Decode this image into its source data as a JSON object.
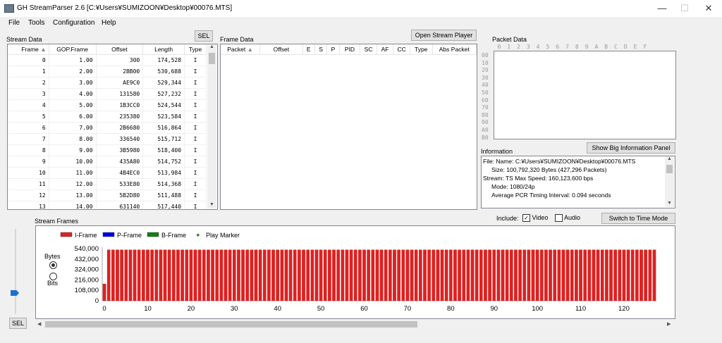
{
  "window": {
    "title": "GH StreamParser 2.6 [C:¥Users¥SUMIZOON¥Desktop¥00076.MTS]",
    "minimize": "—",
    "maximize": "☐",
    "close": "✕"
  },
  "menu": [
    "File",
    "Tools",
    "Configuration",
    "Help"
  ],
  "stream_data": {
    "label": "Stream Data",
    "sel_label": "SEL",
    "columns": [
      "Frame",
      "GOP.Frame",
      "Offset",
      "Length",
      "Type"
    ],
    "rows": [
      [
        "0",
        "1.00",
        "300",
        "174,528",
        "I"
      ],
      [
        "1",
        "2.00",
        "2BB00",
        "530,688",
        "I"
      ],
      [
        "2",
        "3.00",
        "AE9C0",
        "529,344",
        "I"
      ],
      [
        "3",
        "4.00",
        "131580",
        "527,232",
        "I"
      ],
      [
        "4",
        "5.00",
        "1B3CC0",
        "524,544",
        "I"
      ],
      [
        "5",
        "6.00",
        "235380",
        "523,584",
        "I"
      ],
      [
        "6",
        "7.00",
        "2B6680",
        "516,864",
        "I"
      ],
      [
        "7",
        "8.00",
        "336540",
        "515,712",
        "I"
      ],
      [
        "8",
        "9.00",
        "3B5980",
        "518,400",
        "I"
      ],
      [
        "9",
        "10.00",
        "435A80",
        "514,752",
        "I"
      ],
      [
        "10",
        "11.00",
        "4B4EC0",
        "513,984",
        "I"
      ],
      [
        "11",
        "12.00",
        "533E80",
        "514,368",
        "I"
      ],
      [
        "12",
        "13.00",
        "5B2D80",
        "511,488",
        "I"
      ],
      [
        "13",
        "14.00",
        "631140",
        "517,440",
        "I"
      ]
    ]
  },
  "frame_data": {
    "label": "Frame Data",
    "open_player_label": "Open Stream Player",
    "columns": [
      "Packet",
      "Offset",
      "E",
      "S",
      "P",
      "PID",
      "SC",
      "AF",
      "CC",
      "Type",
      "Abs Packet"
    ]
  },
  "packet_data": {
    "label": "Packet Data",
    "columns": [
      "0",
      "1",
      "2",
      "3",
      "4",
      "5",
      "6",
      "7",
      "8",
      "9",
      "A",
      "B",
      "C",
      "D",
      "E",
      "F"
    ],
    "rows": [
      "00",
      "10",
      "20",
      "30",
      "40",
      "50",
      "60",
      "70",
      "80",
      "90",
      "A0",
      "B0"
    ]
  },
  "information": {
    "label": "Information",
    "big_panel_label": "Show Big Information Panel",
    "lines": [
      "File:   Name: C:¥Users¥SUMIZOON¥Desktop¥00076.MTS",
      "Size: 100,792,320 Bytes (427,296 Packets)",
      "Stream: TS Max Speed: 160,123,600 bps",
      "Mode: 1080/24p",
      "Average PCR Timing Interval: 0.094 seconds"
    ]
  },
  "include": {
    "label": "Include:",
    "video_label": "Video",
    "video_checked": true,
    "audio_label": "Audio",
    "audio_checked": false,
    "switch_label": "Switch to Time Mode"
  },
  "stream_frames": {
    "label": "Stream Frames",
    "bytes_label": "Bytes",
    "bits_label": "Bits",
    "bytes_selected": true,
    "sel_label": "SEL"
  },
  "chart_data": {
    "type": "bar",
    "legend": [
      {
        "name": "I-Frame",
        "color": "#e02020"
      },
      {
        "name": "P-Frame",
        "color": "#0000e0"
      },
      {
        "name": "B-Frame",
        "color": "#108010"
      },
      {
        "name": "Play Marker",
        "color": "#108010"
      }
    ],
    "y_ticks": [
      "540,000",
      "432,000",
      "324,000",
      "216,000",
      "108,000",
      "0"
    ],
    "ylim": [
      0,
      540000
    ],
    "x_ticks": [
      "0",
      "10",
      "20",
      "30",
      "40",
      "50",
      "60",
      "70",
      "80",
      "90",
      "100",
      "110",
      "120"
    ],
    "xlim": [
      0,
      127
    ],
    "frames": 128,
    "first_value": 174528,
    "typical_value": 528000,
    "color": "#e02020"
  }
}
